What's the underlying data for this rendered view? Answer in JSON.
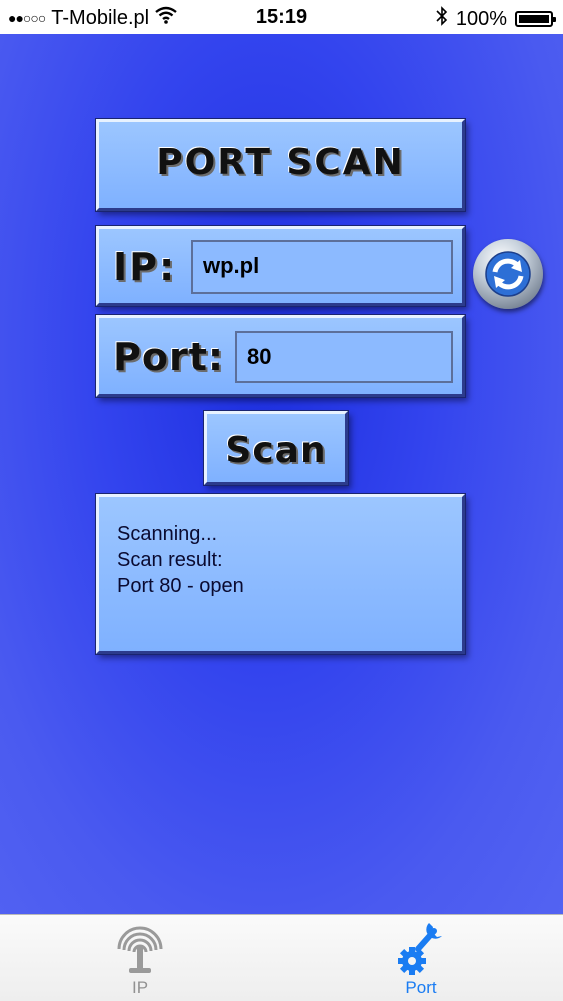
{
  "statusbar": {
    "carrier": "T-Mobile.pl",
    "time": "15:19",
    "battery": "100%"
  },
  "app": {
    "title": "PORT SCAN",
    "ip_label": "IP:",
    "ip_value": "wp.pl",
    "port_label": "Port:",
    "port_value": "80",
    "scan_button": "Scan",
    "result_lines": [
      "Scanning...",
      "Scan result:",
      "Port 80 - open"
    ]
  },
  "tabs": [
    {
      "label": "IP",
      "icon": "antenna-icon",
      "selected": false
    },
    {
      "label": "Port",
      "icon": "gear-wrench-icon",
      "selected": true
    }
  ],
  "colors": {
    "background": "#3344ee",
    "panel": "#8cbaff",
    "tab_active": "#1a7cf2",
    "tab_inactive": "#929292"
  }
}
